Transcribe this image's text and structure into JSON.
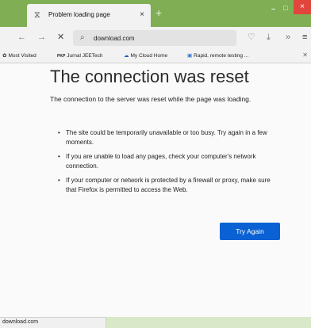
{
  "tab": {
    "icon": "warning-page-icon",
    "title": "Problem loading page",
    "close": "×"
  },
  "new_tab": "+",
  "window_controls": {
    "minimize": "–",
    "maximize": "□",
    "close": "×"
  },
  "nav": {
    "back": "←",
    "forward": "→",
    "stop": "✕",
    "search": "⌕",
    "url": "download.com",
    "pocket": "♡",
    "download": "⤓",
    "overflow": "»",
    "menu": "≡"
  },
  "bookmarks": {
    "items": [
      {
        "icon": "✿",
        "label": "Most Visited"
      },
      {
        "icon": "PKP",
        "label": "Jurnal JEETech"
      },
      {
        "icon": "☁",
        "label": "My Cloud Home"
      },
      {
        "icon": "▣",
        "label": "Rapid, remote testing ..."
      }
    ],
    "close": "✕"
  },
  "error": {
    "title": "The connection was reset",
    "description": "The connection to the server was reset while the page was loading.",
    "bullets": [
      "The site could be temporarily unavailable or too busy. Try again in a few moments.",
      "If you are unable to load any pages, check your computer's network connection.",
      "If your computer or network is protected by a firewall or proxy, make sure that Firefox is permitted to access the Web."
    ],
    "try_again": "Try Again"
  },
  "status": "download.com",
  "colors": {
    "titlebar": "#7fae55",
    "accent": "#0a61d3",
    "close": "#e2453c"
  }
}
